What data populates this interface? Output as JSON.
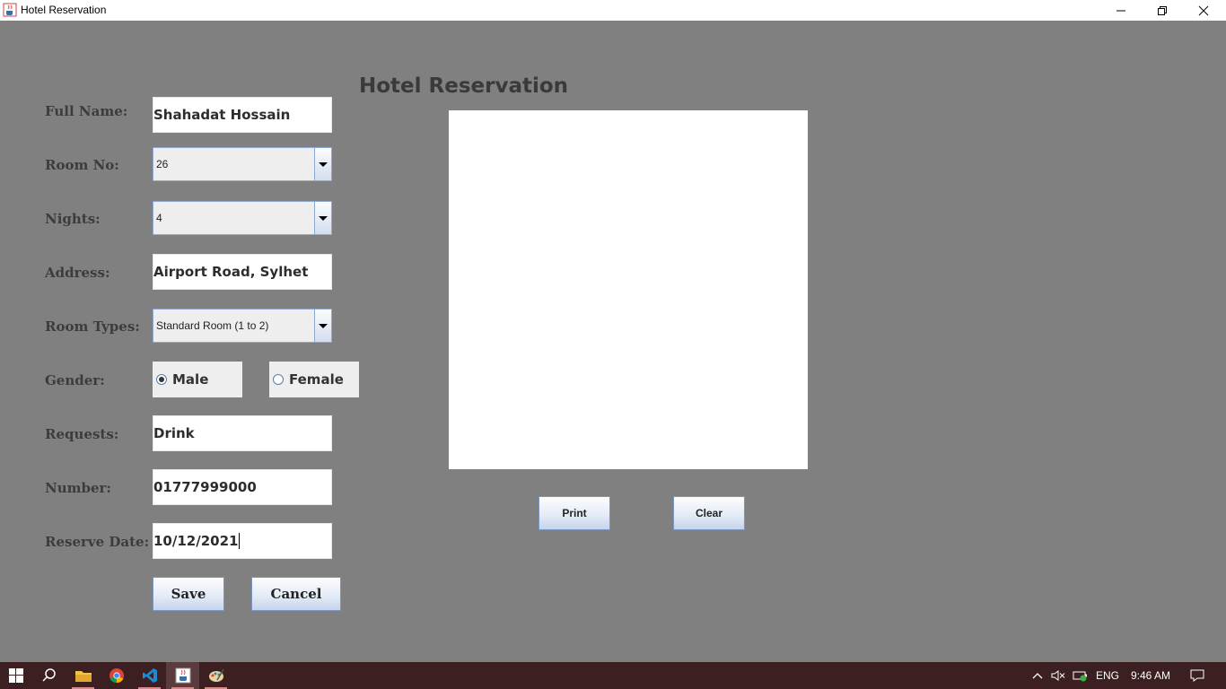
{
  "window": {
    "title": "Hotel Reservation",
    "controls": [
      "minimize-icon",
      "restore-icon",
      "close-icon"
    ]
  },
  "form": {
    "heading": "Hotel Reservation",
    "labels": {
      "full_name": "Full Name:",
      "room_no": "Room No:",
      "nights": "Nights:",
      "address": "Address:",
      "room_types": "Room Types:",
      "gender": "Gender:",
      "requests": "Requests:",
      "number": "Number:",
      "reserve_date": "Reserve Date:"
    },
    "values": {
      "full_name": "Shahadat Hossain",
      "room_no": "26",
      "nights": "4",
      "address": "Airport Road, Sylhet",
      "room_type": "Standard Room (1 to 2)",
      "requests": "Drink",
      "number": "01777999000",
      "reserve_date": "10/12/2021"
    },
    "gender_options": [
      {
        "label": "Male",
        "selected": true
      },
      {
        "label": "Female",
        "selected": false
      }
    ],
    "buttons": {
      "save": "Save",
      "cancel": "Cancel",
      "print": "Print",
      "clear": "Clear"
    }
  },
  "taskbar": {
    "apps": [
      "windows-start-icon",
      "search-icon",
      "file-explorer-icon",
      "chrome-icon",
      "vscode-icon",
      "java-app-icon",
      "paint-icon"
    ],
    "tray": {
      "language": "ENG",
      "time": "9:46 AM"
    }
  },
  "colors": {
    "window_bg": "#808080",
    "taskbar_bg": "#3b1f21",
    "button_border": "#7b94c0"
  }
}
